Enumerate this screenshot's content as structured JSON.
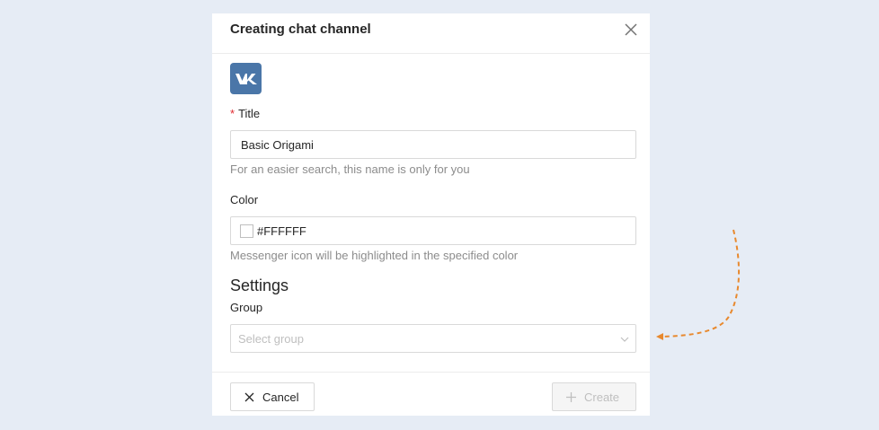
{
  "modal": {
    "title": "Creating chat channel",
    "logo_icon": "vk-logo-icon"
  },
  "form": {
    "title_label": "Title",
    "title_value": "Basic Origami",
    "title_hint": "For an easier search, this name is only for you",
    "color_label": "Color",
    "color_value": "#FFFFFF",
    "color_hint": "Messenger icon will be highlighted in the specified color",
    "settings_heading": "Settings",
    "group_label": "Group",
    "group_placeholder": "Select group"
  },
  "footer": {
    "cancel_label": "Cancel",
    "create_label": "Create"
  },
  "colors": {
    "brand_vk": "#4a76a8",
    "required": "#e0282e",
    "annotation_arrow": "#e8892e"
  }
}
